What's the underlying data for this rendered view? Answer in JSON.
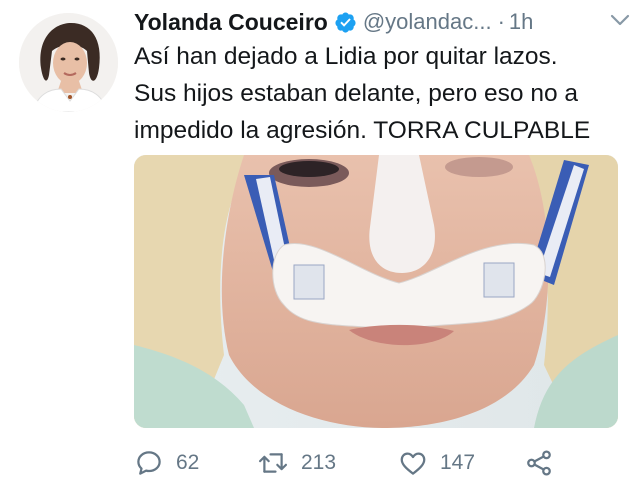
{
  "tweet": {
    "author_name": "Yolanda Couceiro",
    "handle": "@yolandac...",
    "separator": "·",
    "time": "1h",
    "text": "Así han dejado a Lidia por quitar lazos.\nSus hijos estaban delante, pero eso no a\nimpedido la agresión. TORRA CULPABLE",
    "verified": true,
    "media": {
      "description_icon": "photo"
    }
  },
  "actions": {
    "replies": "62",
    "retweets": "213",
    "likes": "147"
  },
  "colors": {
    "text": "#14171a",
    "secondary": "#657786",
    "verified_blue": "#1da1f2"
  }
}
